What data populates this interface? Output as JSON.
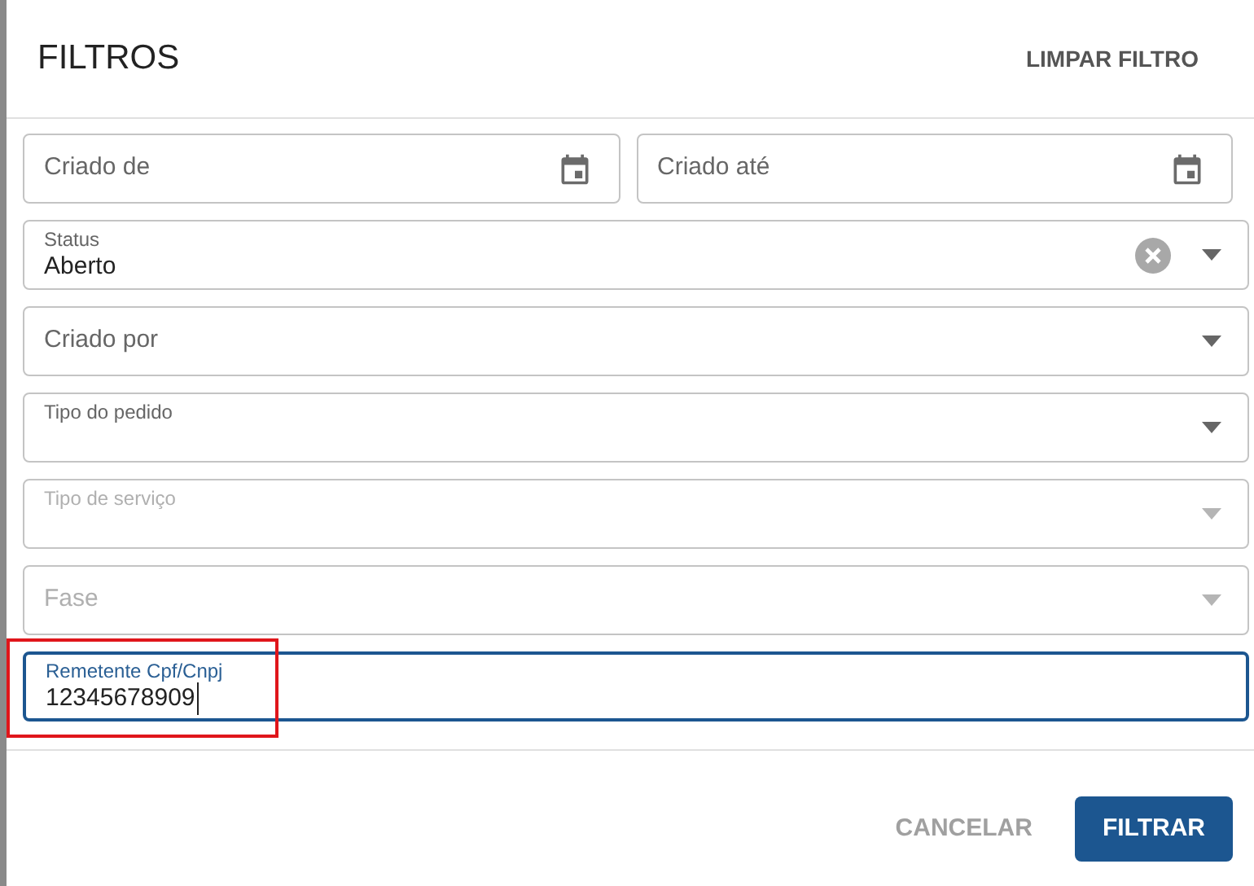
{
  "dialog": {
    "title": "FILTROS",
    "clear_button": "LIMPAR FILTRO"
  },
  "fields": [
    {
      "kind": "date",
      "label": "Criado de",
      "floating": false,
      "disabled": false,
      "focused": false
    },
    {
      "kind": "date",
      "label": "Criado até",
      "floating": false,
      "disabled": false,
      "focused": false
    },
    {
      "kind": "select",
      "label": "Status",
      "value": "Aberto",
      "floating": true,
      "disabled": false,
      "focused": false,
      "clearable": true
    },
    {
      "kind": "select",
      "label": "Criado por",
      "floating": false,
      "disabled": false,
      "focused": false,
      "clearable": false
    },
    {
      "kind": "select",
      "label": "Tipo do pedido",
      "floating": true,
      "disabled": false,
      "focused": false,
      "clearable": false
    },
    {
      "kind": "select",
      "label": "Tipo de serviço",
      "floating": true,
      "disabled": true,
      "focused": false,
      "clearable": false
    },
    {
      "kind": "select",
      "label": "Fase",
      "floating": false,
      "disabled": true,
      "focused": false,
      "clearable": false
    },
    {
      "kind": "text",
      "label": "Remetente Cpf/Cnpj",
      "value": "12345678909",
      "floating": true,
      "disabled": false,
      "focused": true,
      "annotated": true
    }
  ],
  "actions": {
    "cancel": "CANCELAR",
    "submit": "FILTRAR"
  }
}
